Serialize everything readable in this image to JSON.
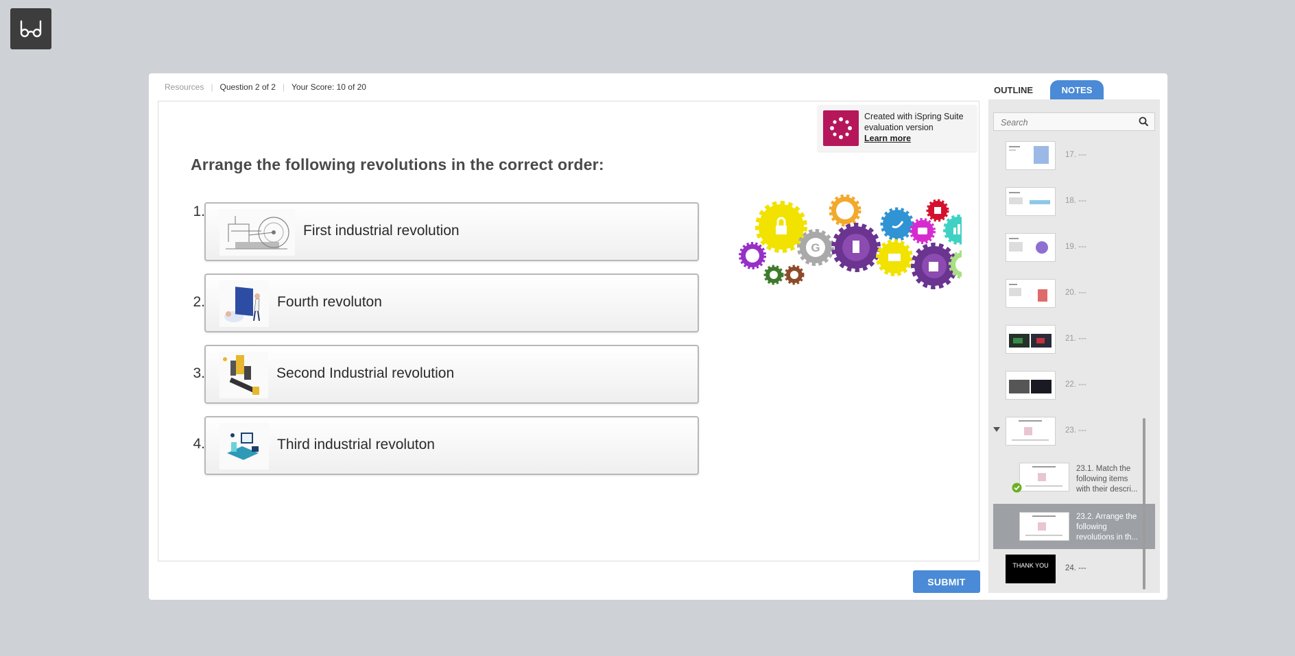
{
  "accessibility": {
    "icon": "glasses-icon"
  },
  "topbar": {
    "resources": "Resources",
    "question": "Question 2 of 2",
    "score": "Your Score: 10 of 20"
  },
  "eval_badge": {
    "line1": "Created with iSpring Suite",
    "line2": "evaluation version",
    "link": "Learn more"
  },
  "question": "Arrange the following revolutions in the correct order:",
  "items": [
    {
      "num": "1.",
      "label": "First industrial revolution"
    },
    {
      "num": "2.",
      "label": "Fourth revoluton"
    },
    {
      "num": "3.",
      "label": "Second Industrial revolution"
    },
    {
      "num": "4.",
      "label": "Third industrial revoluton"
    }
  ],
  "submit": "SUBMIT",
  "sidebar": {
    "tab_outline": "OUTLINE",
    "tab_notes": "NOTES",
    "search_placeholder": "Search",
    "slides": [
      {
        "label": "17. ---"
      },
      {
        "label": "18. ---"
      },
      {
        "label": "19. ---"
      },
      {
        "label": "20. ---"
      },
      {
        "label": "21. ---"
      },
      {
        "label": "22. ---"
      },
      {
        "label": "23. ---"
      }
    ],
    "sub_slides": [
      {
        "label": "23.1. Match the following items with their descri..."
      },
      {
        "label": "23.2.  Arrange the following revolutions in th..."
      }
    ],
    "last_slide": {
      "label": "24. ---",
      "thumb_text": "THANK YOU"
    }
  },
  "colors": {
    "accent": "#4a8ad6",
    "ispring": "#b5175a",
    "selected_row": "#9da0a4",
    "check": "#6ab023"
  }
}
